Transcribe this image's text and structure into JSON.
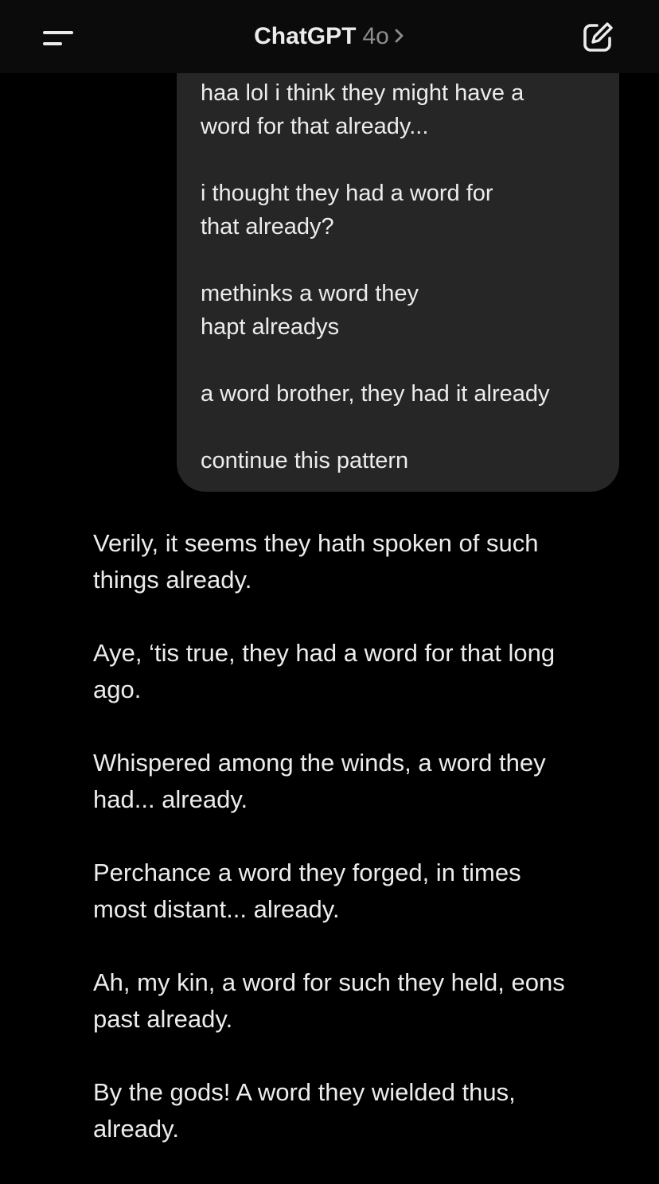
{
  "header": {
    "title": "ChatGPT",
    "model": "4o",
    "menu_icon": "menu-icon",
    "chevron_icon": "chevron-right-icon",
    "compose_icon": "compose-icon"
  },
  "user_message": {
    "paragraphs": [
      "haa lol i think they might have a\nword for that already...",
      "i thought they had a word for\nthat already?",
      "methinks a word they\nhapt alreadys",
      "a word brother, they had it already",
      "continue this pattern"
    ]
  },
  "assistant_message": {
    "paragraphs": [
      "Verily, it seems they hath spoken of such\nthings already.",
      "Aye, ‘tis true, they had a word for that long\nago.",
      "Whispered among the winds, a word they\nhad... already.",
      "Perchance a word they forged, in times\nmost distant... already.",
      "Ah, my kin, a word for such they held, eons\npast already.",
      "By the gods! A word they wielded thus,\nalready."
    ]
  },
  "colors": {
    "background": "#000000",
    "header_bg": "#0b0b0b",
    "bubble_bg": "#262626",
    "text": "#ececec",
    "muted": "#8e8e8e"
  }
}
